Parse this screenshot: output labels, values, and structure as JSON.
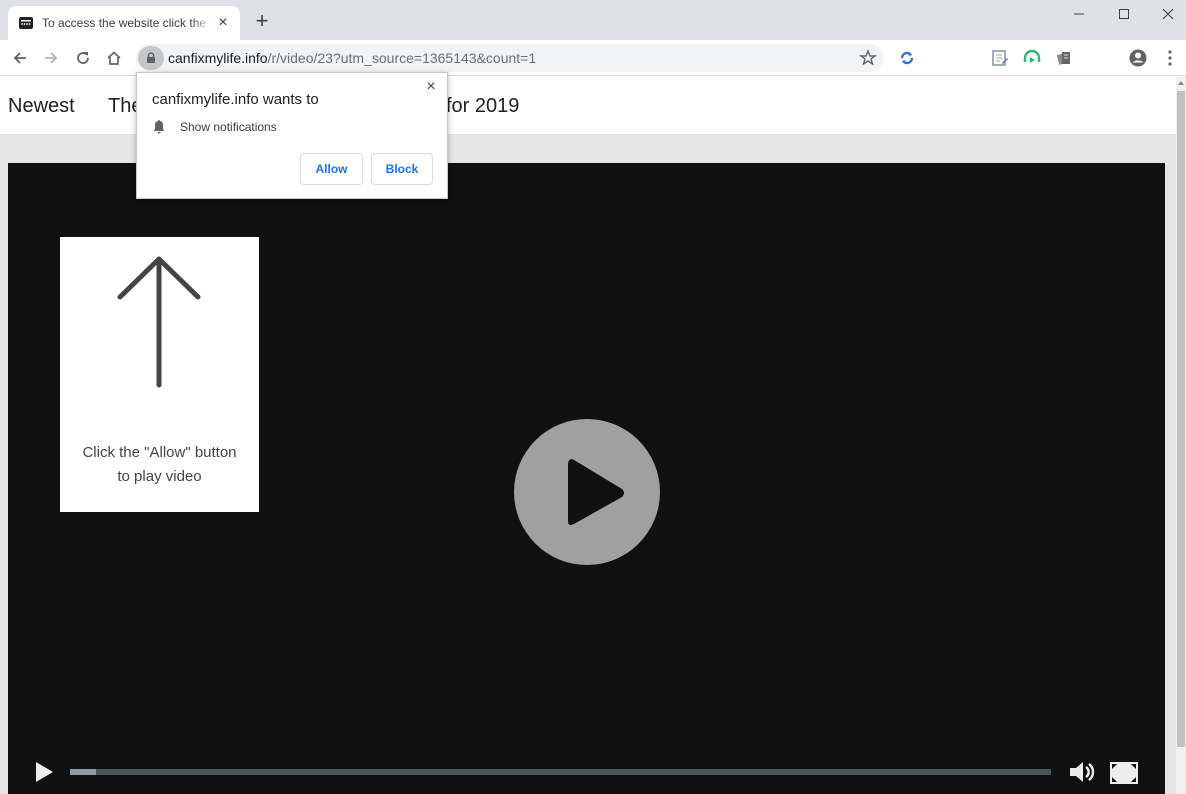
{
  "browser": {
    "tab": {
      "title": "To access the website click the \"Allow\" button",
      "close_icon": "close-icon",
      "favicon": "site-favicon"
    },
    "new_tab_icon": "plus-icon",
    "window_controls": [
      "minimize-icon",
      "maximize-icon",
      "close-icon"
    ],
    "nav_icons": [
      "back-arrow-icon",
      "forward-arrow-icon",
      "reload-icon",
      "home-icon"
    ],
    "address": {
      "domain": "canfixmylife.info",
      "path": "/r/video/23?utm_source=1365143&count=1",
      "lock_icon": "lock-icon",
      "star_icon": "star-icon"
    },
    "extensions": [
      "sync-extension-icon",
      "notes-extension-icon",
      "headphones-extension-icon",
      "stack-extension-icon"
    ],
    "profile_icon": "account-circle-icon",
    "menu_icon": "more-vert-icon"
  },
  "page": {
    "nav": {
      "item1": "Newest",
      "item2": "The",
      "item2_tail": "for 2019"
    },
    "hint": {
      "icon": "arrow-up-icon",
      "line1": "Click the \"Allow\" button",
      "line2": "to play video"
    },
    "player": {
      "big_play_icon": "play-circle-icon",
      "play_icon": "play-icon",
      "progress": 0.027,
      "volume_icon": "volume-icon",
      "fullscreen_icon": "fullscreen-icon"
    }
  },
  "popup": {
    "title": "canfixmylife.info wants to",
    "permission": "Show notifications",
    "permission_icon": "bell-icon",
    "allow_label": "Allow",
    "block_label": "Block",
    "close_label": "×"
  },
  "labels": {
    "tab_close": "×",
    "new_tab": "+"
  },
  "colors": {
    "accent": "#1a73e8",
    "video_bg": "#111111",
    "chrome_frame": "#dee1e6"
  }
}
